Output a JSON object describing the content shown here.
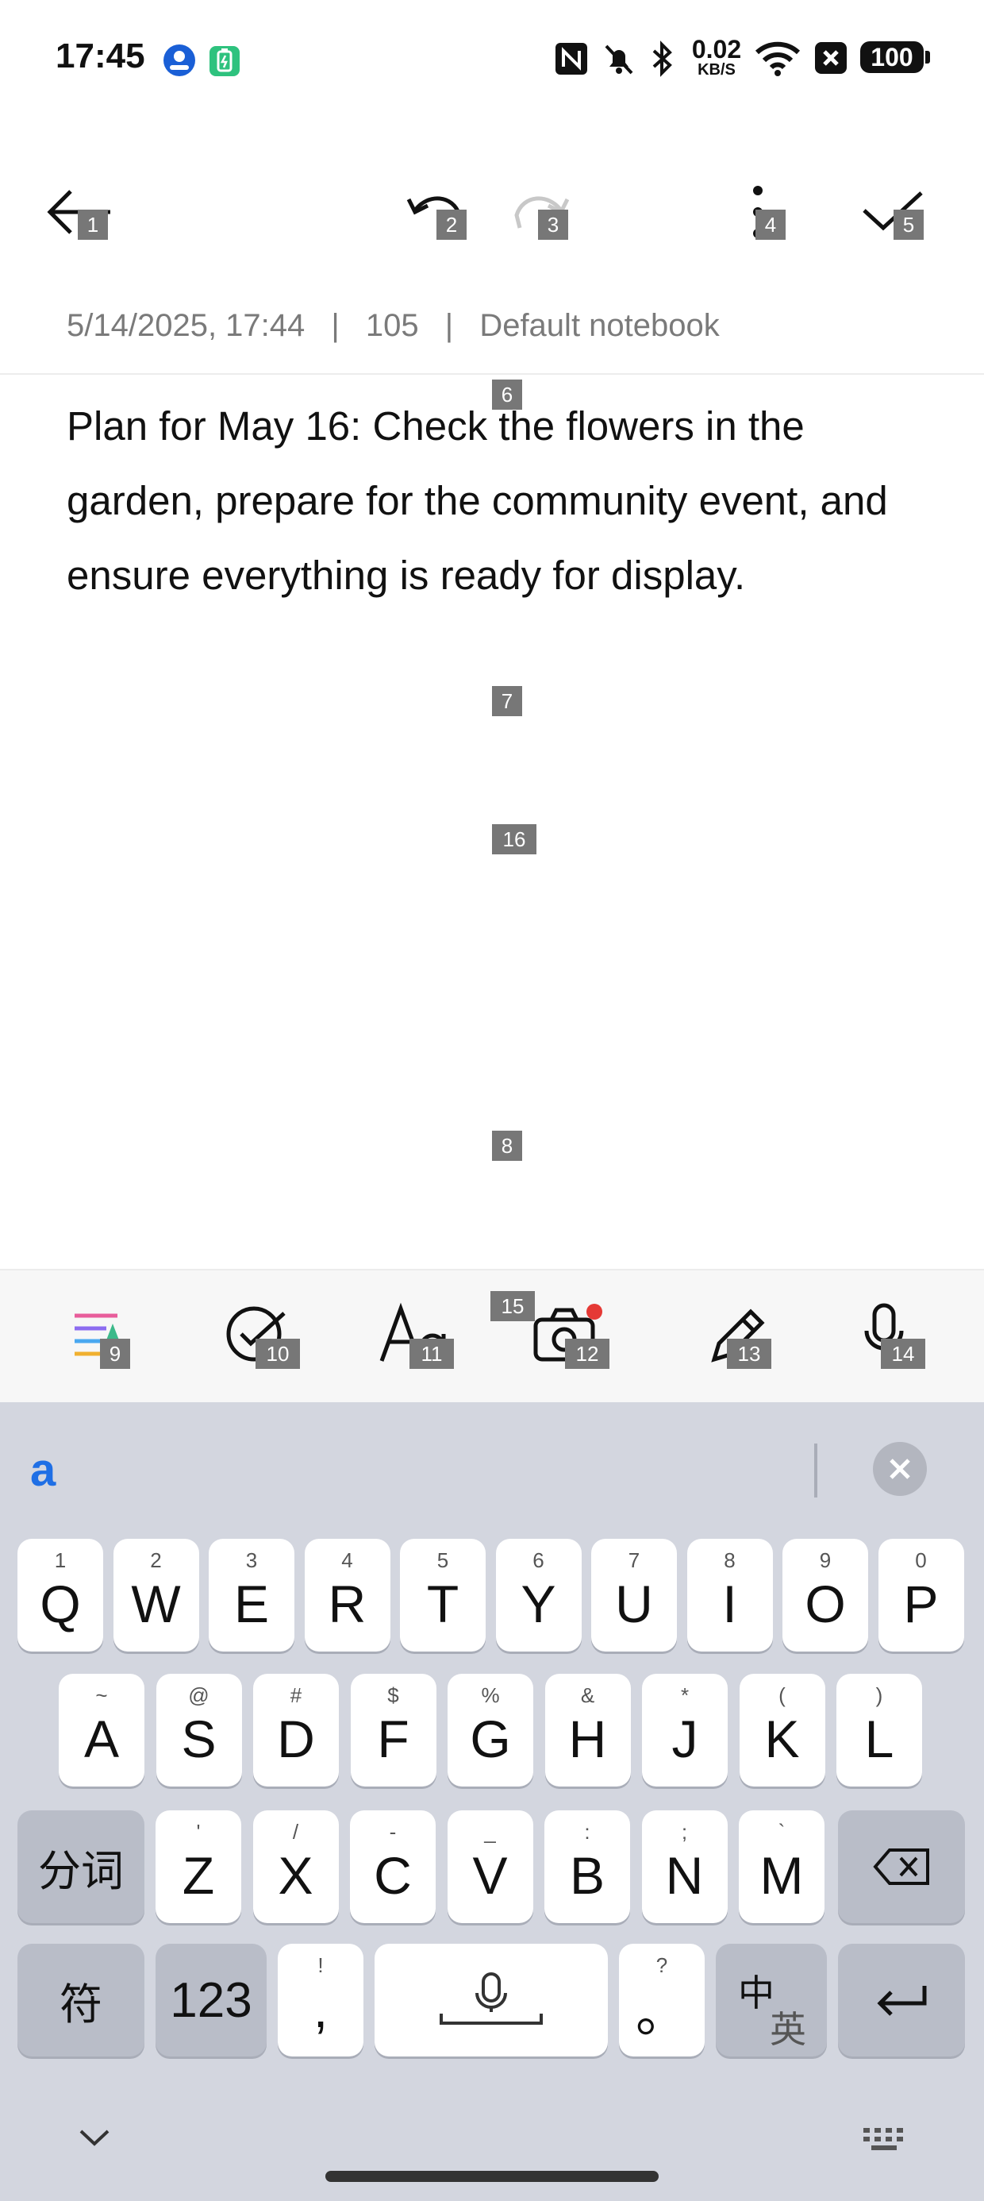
{
  "status_bar": {
    "time": "17:45",
    "net_speed_top": "0.02",
    "net_speed_unit": "KB/S",
    "battery": "100",
    "icons": [
      "app-badge-icon",
      "battery-saver-icon",
      "nfc-icon",
      "mute-icon",
      "bluetooth-icon",
      "wifi-icon",
      "close-box-icon"
    ]
  },
  "toolbar": {
    "back_badge": "1",
    "undo_badge": "2",
    "redo_badge": "3",
    "more_badge": "4",
    "done_badge": "5"
  },
  "note_meta": {
    "date": "5/14/2025, 17:44",
    "sep1": "|",
    "count": "105",
    "sep2": "|",
    "notebook": "Default notebook"
  },
  "note": {
    "text": "Plan for May 16: Check the flowers in the garden, prepare for the community event, and ensure everything is ready for display.",
    "badges": [
      "6",
      "7",
      "16",
      "8"
    ]
  },
  "format_bar": {
    "badges": [
      "9",
      "10",
      "11",
      "12",
      "13",
      "14",
      "15"
    ],
    "icons": [
      "style-list-icon",
      "checklist-icon",
      "text-format-icon",
      "camera-icon",
      "pen-icon",
      "mic-icon"
    ],
    "camera_dot_color": "#e53935"
  },
  "keyboard": {
    "candidate": "a",
    "row1": [
      {
        "sup": "1",
        "k": "Q"
      },
      {
        "sup": "2",
        "k": "W"
      },
      {
        "sup": "3",
        "k": "E"
      },
      {
        "sup": "4",
        "k": "R"
      },
      {
        "sup": "5",
        "k": "T"
      },
      {
        "sup": "6",
        "k": "Y"
      },
      {
        "sup": "7",
        "k": "U"
      },
      {
        "sup": "8",
        "k": "I"
      },
      {
        "sup": "9",
        "k": "O"
      },
      {
        "sup": "0",
        "k": "P"
      }
    ],
    "row2": [
      {
        "sup": "~",
        "k": "A"
      },
      {
        "sup": "@",
        "k": "S"
      },
      {
        "sup": "#",
        "k": "D"
      },
      {
        "sup": "$",
        "k": "F"
      },
      {
        "sup": "%",
        "k": "G"
      },
      {
        "sup": "&",
        "k": "H"
      },
      {
        "sup": "*",
        "k": "J"
      },
      {
        "sup": "(",
        "k": "K"
      },
      {
        "sup": ")",
        "k": "L"
      }
    ],
    "row3_left": "分词",
    "row3": [
      {
        "sup": "'",
        "k": "Z"
      },
      {
        "sup": "/",
        "k": "X"
      },
      {
        "sup": "-",
        "k": "C"
      },
      {
        "sup": "_",
        "k": "V"
      },
      {
        "sup": ":",
        "k": "B"
      },
      {
        "sup": ";",
        "k": "N"
      },
      {
        "sup": "`",
        "k": "M"
      }
    ],
    "row4": {
      "symbols": "符",
      "numbers": "123",
      "comma_sup": "!",
      "comma": ",",
      "period_sup": "?",
      "period": "。",
      "lang_top": "中",
      "lang_bottom": "英"
    }
  }
}
